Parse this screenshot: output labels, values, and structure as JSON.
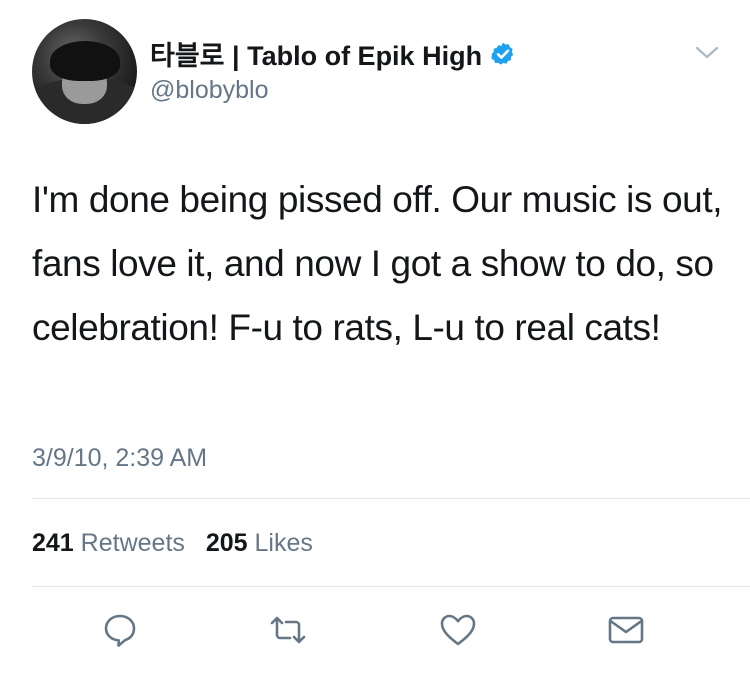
{
  "tweet": {
    "display_name": "타블로 | Tablo of Epik High",
    "handle": "@blobyblo",
    "text": "I'm done being pissed off. Our music is out, fans love it, and now I got a show to do, so celebration! F-u to rats, L-u to real cats!",
    "timestamp": "3/9/10, 2:39 AM",
    "retweets_count": "241",
    "retweets_label": "Retweets",
    "likes_count": "205",
    "likes_label": "Likes"
  },
  "icons": {
    "verified": "verified-badge-icon",
    "menu": "chevron-down-icon",
    "reply": "reply-icon",
    "retweet": "retweet-icon",
    "like": "heart-icon",
    "share": "envelope-icon"
  },
  "colors": {
    "verified_blue": "#1da1f2",
    "secondary_text": "#657786",
    "icon_gray": "#657786",
    "divider": "#e1e8ed"
  }
}
